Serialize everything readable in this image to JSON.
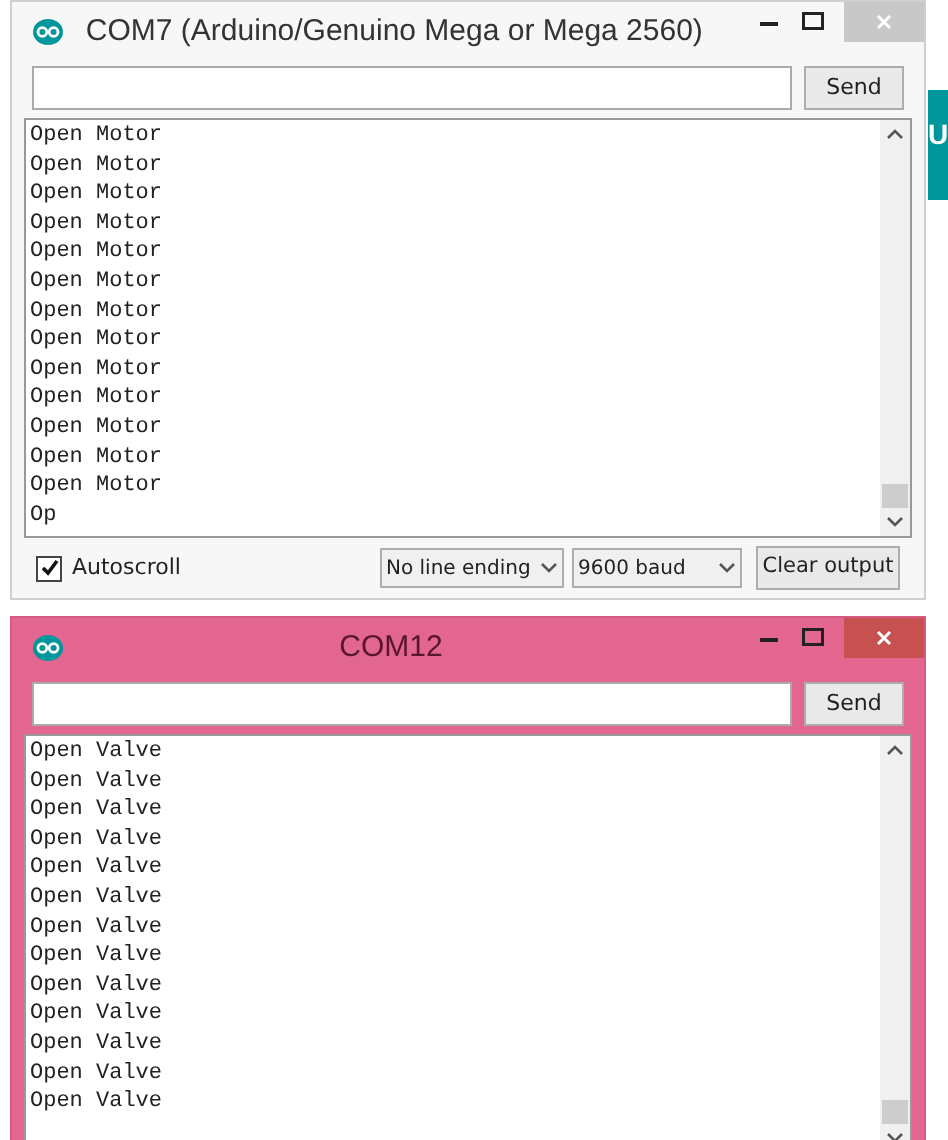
{
  "background_app": {
    "fragment": "U"
  },
  "windows": [
    {
      "title": "COM7 (Arduino/Genuino Mega or Mega 2560)",
      "active": false,
      "send_button": "Send",
      "output": [
        "Open Motor",
        "Open Motor",
        "Open Motor",
        "Open Motor",
        "Open Motor",
        "Open Motor",
        "Open Motor",
        "Open Motor",
        "Open Motor",
        "Open Motor",
        "Open Motor",
        "Open Motor",
        "Open Motor",
        "Op"
      ],
      "footer": {
        "autoscroll": {
          "label": "Autoscroll",
          "checked": true
        },
        "line_ending": "No line ending",
        "baud": "9600 baud",
        "clear_button": "Clear output"
      }
    },
    {
      "title": "COM12",
      "active": true,
      "send_button": "Send",
      "output": [
        "Open Valve",
        "Open Valve",
        "Open Valve",
        "Open Valve",
        "Open Valve",
        "Open Valve",
        "Open Valve",
        "Open Valve",
        "Open Valve",
        "Open Valve",
        "Open Valve",
        "Open Valve",
        "Open Valve"
      ]
    }
  ]
}
